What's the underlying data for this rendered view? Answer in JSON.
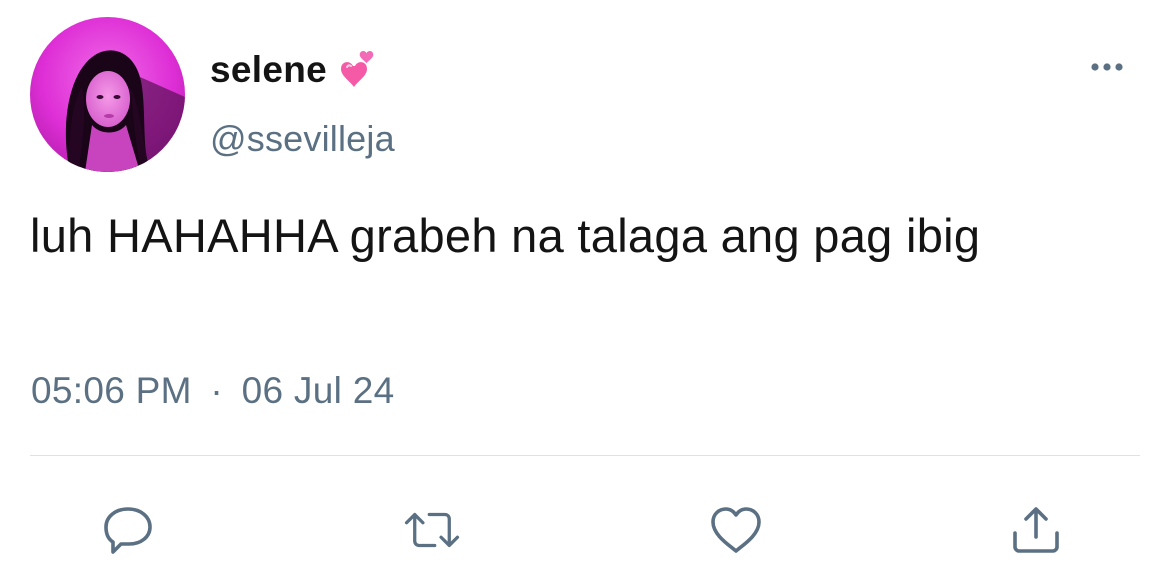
{
  "tweet": {
    "display_name": "selene",
    "name_emoji": "heart-with-ribbon-emoji",
    "handle": "@ssevilleja",
    "text": "luh HAHAHHA grabeh na talaga ang pag ibig",
    "time": "05:06 PM",
    "separator": "·",
    "date": "06 Jul 24"
  },
  "icons": {
    "more": "more-horizontal-icon",
    "reply": "reply-bubble-icon",
    "retweet": "retweet-icon",
    "like": "heart-outline-icon",
    "share": "share-upload-icon"
  },
  "colors": {
    "text_primary": "#141414",
    "text_secondary": "#5b7083",
    "icon_gray": "#5b7083",
    "divider": "#dce3e8",
    "avatar_pink": "#e03ad6"
  }
}
